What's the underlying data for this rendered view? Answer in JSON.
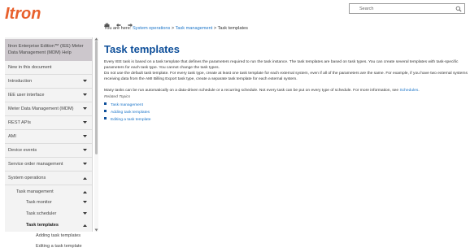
{
  "colors": {
    "brand_orange": "#e8602c",
    "heading_blue": "#0e4f9a",
    "link_blue": "#1a74c8",
    "sidebar_active": "#ccc7cc"
  },
  "header": {
    "logo_text": "Itron",
    "search_placeholder": "Search"
  },
  "toolbar": {
    "print_icon": "print-icon",
    "back_icon": "back-arrow-icon",
    "forward_icon": "forward-arrow-icon"
  },
  "breadcrumb": {
    "prefix": "You are here:",
    "items": [
      "System operations",
      "Task management",
      "Task templates"
    ],
    "sep": ">"
  },
  "sidebar": {
    "title": "Itron Enterprise Edition™ (IEE) Meter Data Management (MDM) Help",
    "items": [
      {
        "label": "New in this document"
      },
      {
        "label": "Introduction"
      },
      {
        "label": "IEE user interface"
      },
      {
        "label": "Meter Data Management (MDM)"
      },
      {
        "label": "REST APIs"
      },
      {
        "label": "AMI"
      },
      {
        "label": "Device events"
      },
      {
        "label": "Service order management"
      },
      {
        "label": "System operations"
      }
    ],
    "sub_items": [
      {
        "label": "Task management"
      },
      {
        "label": "Task monitor"
      },
      {
        "label": "Task scheduler"
      },
      {
        "label": "Task templates"
      },
      {
        "label": "Adding task templates"
      },
      {
        "label": "Editing a task template"
      }
    ]
  },
  "main": {
    "title": "Task templates",
    "p1": "Every IEE task is based on a task template that defines the parameters required to run the task instance. The task templates are based on task types. You can create several templates with task-specific parameters for each task type. You cannot change the task types.",
    "p2": "Do not use the default task template. For every task type, create at least one task template for each external system, even if all of the parameters are the same. For example, if you have two external systems receiving data from the AMI Billing Export task type, create a separate task template for each external system.",
    "p3_pre": "Many tasks can be run automatically on a data-driven schedule or a recurring schedule. Not every task can be put on every type of schedule. For more information, see",
    "p3_link": "Schedules",
    "p3_post": ".",
    "related_title": "Related Topics",
    "related": [
      "Task management",
      "Adding task templates",
      "Editing a task template"
    ]
  }
}
